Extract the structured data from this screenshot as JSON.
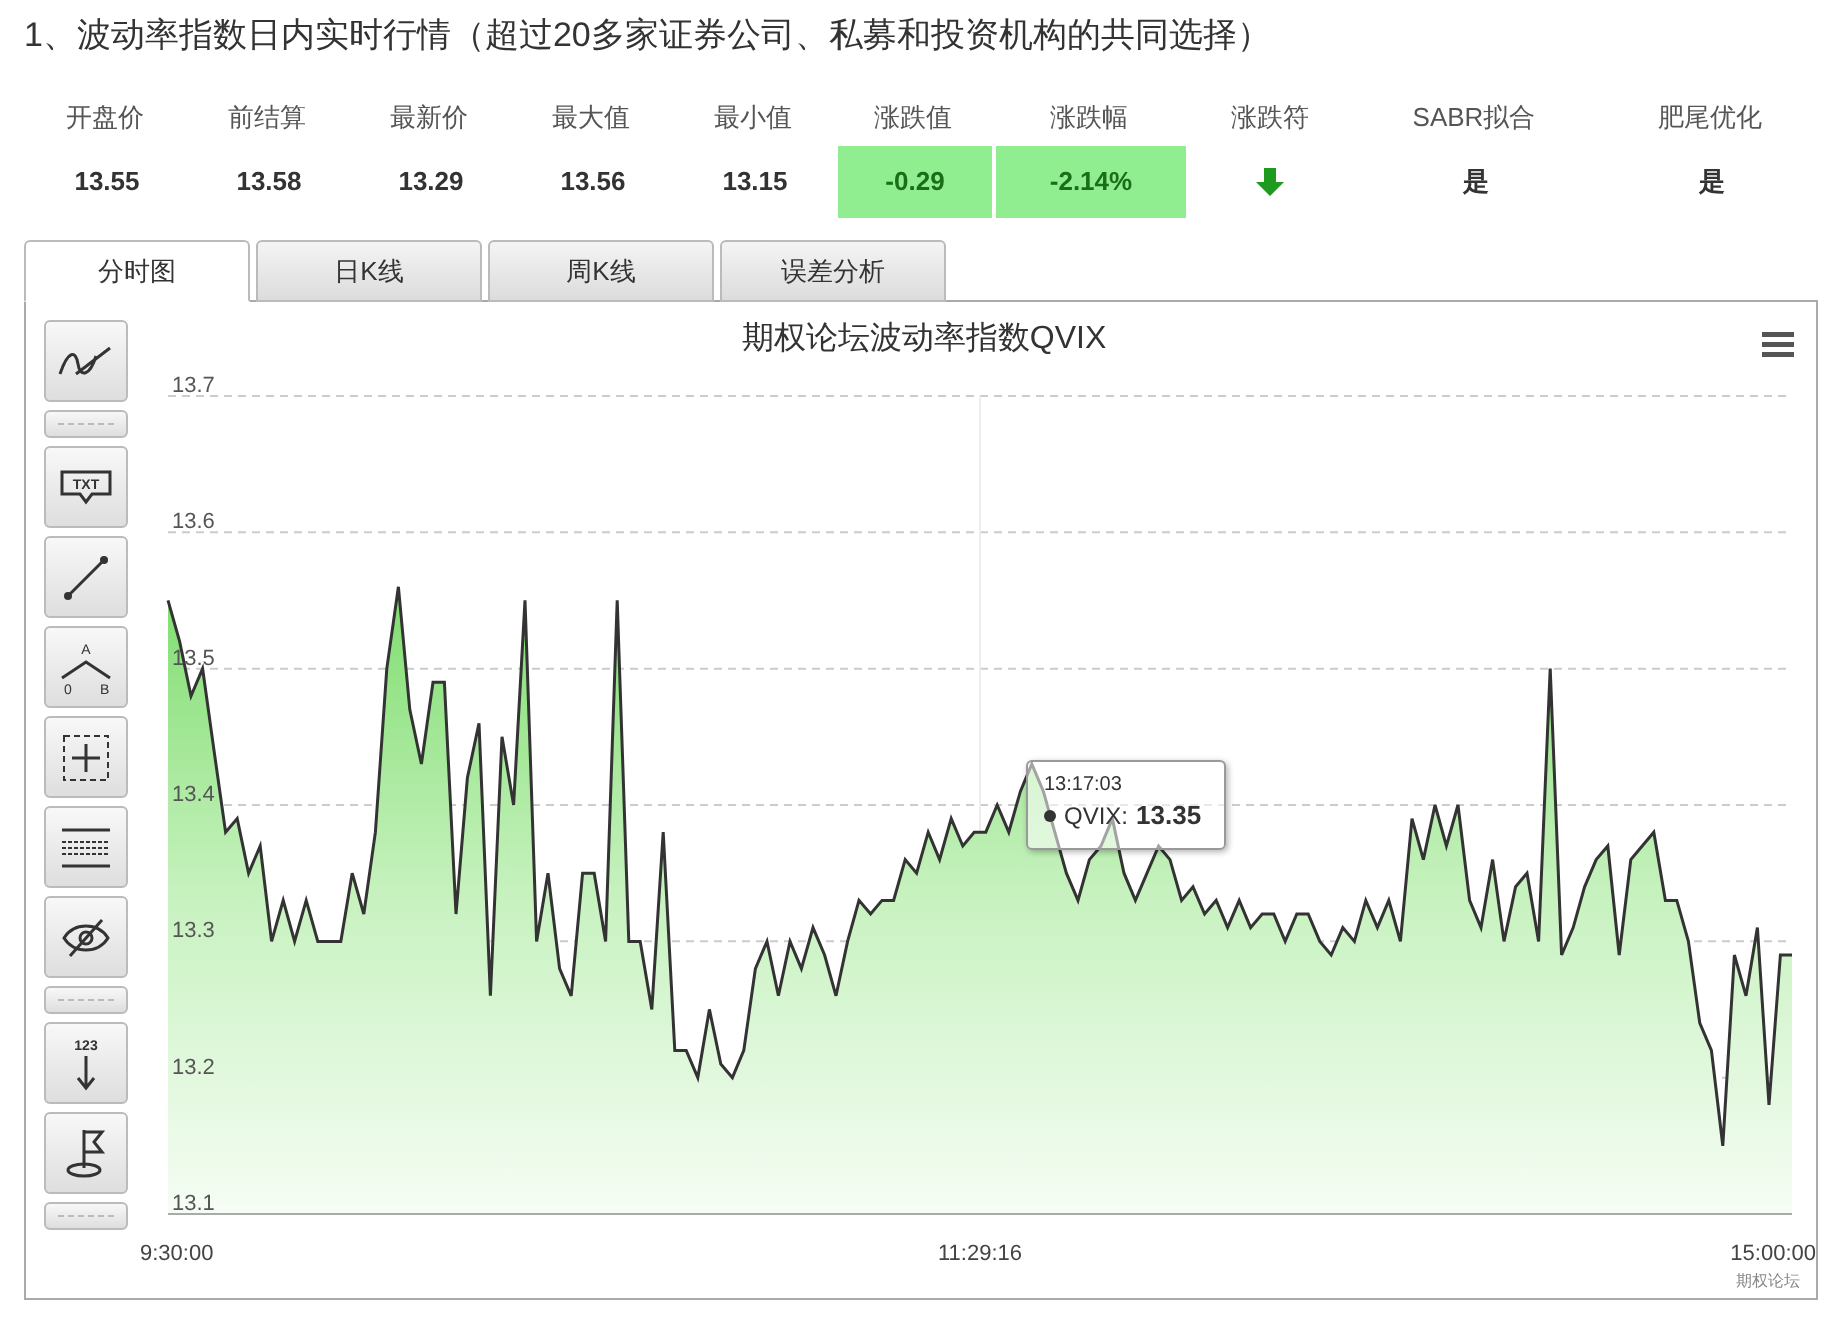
{
  "heading": "1、波动率指数日内实时行情（超过20多家证券公司、私募和投资机构的共同选择）",
  "stats": [
    {
      "label": "开盘价",
      "value": "13.55",
      "kind": "plain"
    },
    {
      "label": "前结算",
      "value": "13.58",
      "kind": "plain"
    },
    {
      "label": "最新价",
      "value": "13.29",
      "kind": "plain"
    },
    {
      "label": "最大值",
      "value": "13.56",
      "kind": "plain"
    },
    {
      "label": "最小值",
      "value": "13.15",
      "kind": "plain"
    },
    {
      "label": "涨跌值",
      "value": "-0.29",
      "kind": "highlight"
    },
    {
      "label": "涨跌幅",
      "value": "-2.14%",
      "kind": "highlight"
    },
    {
      "label": "涨跌符",
      "kind": "down_arrow"
    },
    {
      "label": "SABR拟合",
      "value": "是",
      "kind": "plain"
    },
    {
      "label": "肥尾优化",
      "value": "是",
      "kind": "plain"
    }
  ],
  "tabs": [
    {
      "label": "分时图",
      "selected": true
    },
    {
      "label": "日K线",
      "selected": false
    },
    {
      "label": "周K线",
      "selected": false
    },
    {
      "label": "误差分析",
      "selected": false
    }
  ],
  "toolbar": [
    {
      "kind": "trend"
    },
    {
      "kind": "separator"
    },
    {
      "kind": "text",
      "label": "TXT"
    },
    {
      "kind": "line"
    },
    {
      "kind": "angle",
      "labels": [
        "A",
        "0",
        "B"
      ]
    },
    {
      "kind": "crosshair"
    },
    {
      "kind": "levels"
    },
    {
      "kind": "hide"
    },
    {
      "kind": "separator"
    },
    {
      "kind": "number",
      "label": "123"
    },
    {
      "kind": "flag"
    },
    {
      "kind": "separator"
    }
  ],
  "chart": {
    "credit": "期权论坛",
    "time_labels": [
      "9:30:00",
      "11:29:16",
      "15:00:00"
    ],
    "tooltip": {
      "time": "13:17:03",
      "series": "QVIX:",
      "value": "13.35"
    },
    "chart_data": {
      "type": "area",
      "title": "期权论坛波动率指数QVIX",
      "ylim": [
        13.1,
        13.7
      ],
      "yticks": [
        13.1,
        13.2,
        13.3,
        13.4,
        13.5,
        13.6,
        13.7
      ],
      "grid": true,
      "series": [
        {
          "color": "#333333",
          "values": [
            13.55,
            13.52,
            13.48,
            13.5,
            13.44,
            13.38,
            13.39,
            13.35,
            13.37,
            13.3,
            13.33,
            13.3,
            13.33,
            13.3,
            13.3,
            13.3,
            13.35,
            13.32,
            13.38,
            13.5,
            13.56,
            13.47,
            13.43,
            13.49,
            13.49,
            13.32,
            13.42,
            13.46,
            13.26,
            13.45,
            13.4,
            13.55,
            13.3,
            13.35,
            13.28,
            13.26,
            13.35,
            13.35,
            13.3,
            13.55,
            13.3,
            13.3,
            13.25,
            13.38,
            13.22,
            13.22,
            13.2,
            13.25,
            13.21,
            13.2,
            13.22,
            13.28,
            13.3,
            13.26,
            13.3,
            13.28,
            13.31,
            13.29,
            13.26,
            13.3,
            13.33,
            13.32,
            13.33,
            13.33,
            13.36,
            13.35,
            13.38,
            13.36,
            13.39,
            13.37,
            13.38,
            13.38,
            13.4,
            13.38,
            13.41,
            13.43,
            13.41,
            13.38,
            13.35,
            13.33,
            13.36,
            13.37,
            13.39,
            13.35,
            13.33,
            13.35,
            13.37,
            13.36,
            13.33,
            13.34,
            13.32,
            13.33,
            13.31,
            13.33,
            13.31,
            13.32,
            13.32,
            13.3,
            13.32,
            13.32,
            13.3,
            13.29,
            13.31,
            13.3,
            13.33,
            13.31,
            13.33,
            13.3,
            13.39,
            13.36,
            13.4,
            13.37,
            13.4,
            13.33,
            13.31,
            13.36,
            13.3,
            13.34,
            13.35,
            13.3,
            13.5,
            13.29,
            13.31,
            13.34,
            13.36,
            13.37,
            13.29,
            13.36,
            13.37,
            13.38,
            13.33,
            13.33,
            13.3,
            13.24,
            13.22,
            13.15,
            13.29,
            13.26,
            13.31,
            13.18,
            13.29,
            13.29
          ]
        }
      ]
    }
  }
}
